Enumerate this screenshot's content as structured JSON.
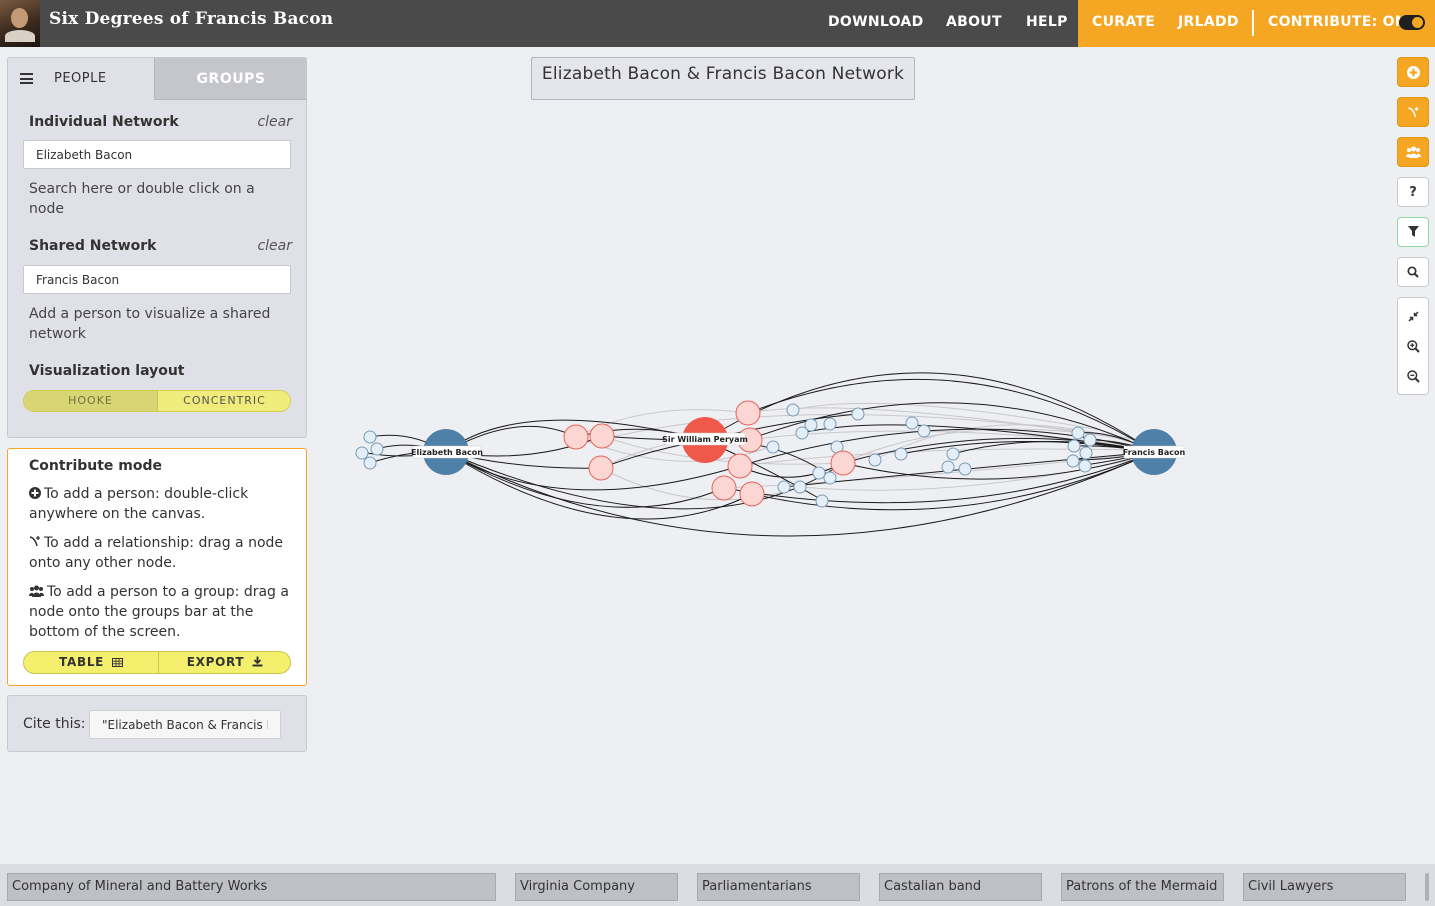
{
  "header": {
    "site_title": "Six Degrees of Francis Bacon",
    "nav": [
      "DOWNLOAD",
      "ABOUT",
      "HELP"
    ],
    "curate": "CURATE",
    "user": "JRLADD",
    "contribute": "CONTRIBUTE: ON",
    "accent_color": "#f5a623"
  },
  "sidebar": {
    "tabs": [
      "PEOPLE",
      "GROUPS"
    ],
    "individual_label": "Individual Network",
    "individual_value": "Elizabeth Bacon",
    "individual_help": "Search here or double click on a node",
    "shared_label": "Shared Network",
    "shared_value": "Francis Bacon",
    "shared_help": "Add a person to visualize a shared network",
    "clear": "clear",
    "layout_label": "Visualization layout",
    "layout_options": [
      "HOOKE",
      "CONCENTRIC"
    ],
    "layout_selected": "HOOKE"
  },
  "contribute": {
    "title": "Contribute mode",
    "add_person": "To add a person: double-click anywhere on the canvas.",
    "add_relationship": "To add a relationship: drag a node onto any other node.",
    "add_group": "To add a person to a group: drag a node onto the groups bar at the bottom of the screen.",
    "table_button": "TABLE",
    "export_button": "EXPORT"
  },
  "cite": {
    "label": "Cite this:",
    "value": "\"Elizabeth Bacon & Francis Bacon Network\""
  },
  "network": {
    "title": "Elizabeth Bacon & Francis Bacon Network",
    "nodes": {
      "left": "Elizabeth Bacon",
      "center": "Sir William Peryam",
      "right": "Francis Bacon"
    }
  },
  "groups": [
    "Company of Mineral and Battery Works",
    "Virginia Company",
    "Parliamentarians",
    "Castalian band",
    "Patrons of the Mermaid ...",
    "Civil Lawyers"
  ]
}
